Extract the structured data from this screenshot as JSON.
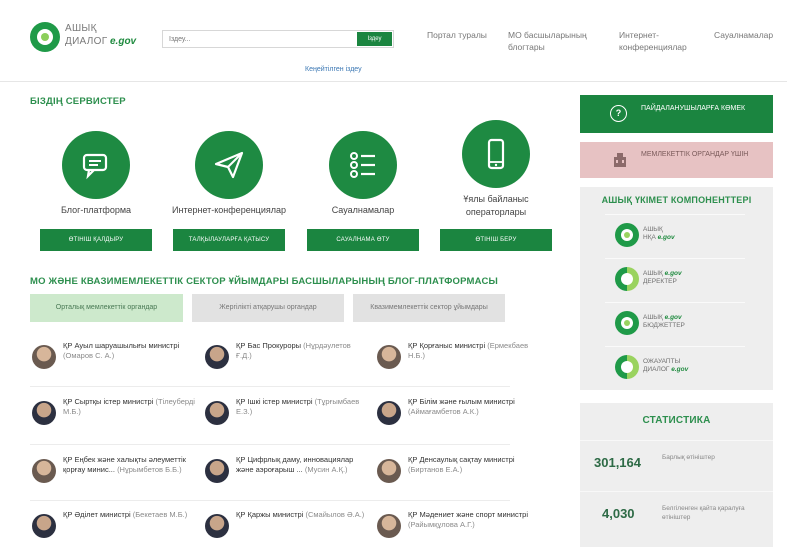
{
  "header": {
    "logo_line1": "АШЫҚ",
    "logo_line2": "ДИАЛОГ",
    "logo_egov": "e.gov",
    "search_placeholder": "Іздеу...",
    "search_button": "Іздеу",
    "advanced_search": "Кеңейтілген іздеу",
    "nav": [
      "Портал туралы",
      "МО басшыларының блогтары",
      "Интернет-конференциялар",
      "Сауалнамалар"
    ]
  },
  "services": {
    "title": "БІЗДІҢ СЕРВИСТЕР",
    "items": [
      {
        "label": "Блог-платформа",
        "button": "ӨТІНІШ ҚАЛДЫРУ",
        "icon": "chat-icon"
      },
      {
        "label": "Интернет-конференциялар",
        "button": "ТАЛҚЫЛАУЛАРҒА ҚАТЫСУ",
        "icon": "paper-plane-icon"
      },
      {
        "label": "Сауалнамалар",
        "button": "САУАЛНАМА ӨТУ",
        "icon": "checklist-icon"
      },
      {
        "label": "Ұялы байланыс операторлары",
        "button": "ӨТІНІШ БЕРУ",
        "icon": "mobile-phone-icon"
      }
    ]
  },
  "blogs": {
    "title": "МО ЖӘНЕ КВАЗИМЕМЛЕКЕТТІК СЕКТОР ҰЙЫМДАРЫ БАСШЫЛАРЫНЫҢ БЛОГ-ПЛАТФОРМАСЫ",
    "filters": [
      "Орталық мемлекеттік органдар",
      "Жергілікті атқарушы органдар",
      "Квазимемлекеттік сектор ұйымдары"
    ],
    "items": [
      {
        "title": "ҚР Ауыл шаруашылығы министрі",
        "who": "(Омаров С. А.)"
      },
      {
        "title": "ҚР Бас Прокуроры",
        "who": "(Нұрдәулетов Ғ.Д.)"
      },
      {
        "title": "ҚР Қорғаныс министрі",
        "who": "(Ермекбаев Н.Б.)"
      },
      {
        "title": "ҚР Сыртқы істер министрі",
        "who": "(Тілеуберді М.Б.)"
      },
      {
        "title": "ҚР Ішкі істер министрі",
        "who": "(Тұрғымбаев Е.З.)"
      },
      {
        "title": "ҚР Білім және ғылым министрі",
        "who": "(Аймағамбетов А.К.)"
      },
      {
        "title": "ҚР Еңбек және халықты әлеуметтік қорғау минис...",
        "who": "(Нұрымбетов Б.Б.)"
      },
      {
        "title": "ҚР Цифрлық даму, инновациялар және аэроғарыш ...",
        "who": "(Мусин А.Қ.)"
      },
      {
        "title": "ҚР Денсаулық сақтау министрі",
        "who": "(Биртанов Е.А.)"
      },
      {
        "title": "ҚР Әділет министрі",
        "who": "(Бекетаев М.Б.)"
      },
      {
        "title": "ҚР Қаржы министрі",
        "who": "(Смайылов Ә.А.)"
      },
      {
        "title": "ҚР Мәдениет және спорт министрі",
        "who": "(Райымқұлова А.Г.)"
      }
    ]
  },
  "sidebar": {
    "help_button": "ПАЙДАЛАНУШЫЛАРҒА КӨМЕК",
    "gov_button": "МЕМЛЕКЕТТІК ОРГАНДАР ҮШІН",
    "components_title": "АШЫҚ ҮКІМЕТ КОМПОНЕНТТЕРІ",
    "components": [
      {
        "line1": "АШЫҚ",
        "line2": "НҚА",
        "brand": "e.gov"
      },
      {
        "line1": "АШЫҚ",
        "line2": "ДЕРЕКТЕР",
        "brand": "e.gov"
      },
      {
        "line1": "АШЫҚ",
        "line2": "БЮДЖЕТТЕР",
        "brand": "e.gov"
      },
      {
        "line1": "ОЖАУАПТЫ",
        "line2": "ДИАЛОГ",
        "brand": "e.gov"
      }
    ],
    "stats_title": "СТАТИСТИКА",
    "stats": [
      {
        "value": "301,164",
        "label": "Барлық өтініштер"
      },
      {
        "value": "4,030",
        "label": "Белгіленген қайта қаралуға өтініштер"
      }
    ]
  }
}
